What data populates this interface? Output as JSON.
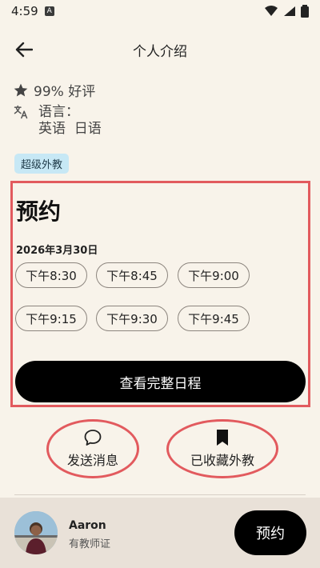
{
  "status_bar": {
    "time": "4:59",
    "sim_label": "A"
  },
  "header": {
    "title": "个人介绍"
  },
  "profile": {
    "rating": "99% 好评",
    "language_label": "语言：",
    "languages": "英语  日语",
    "badge": "超级外教"
  },
  "booking": {
    "title": "预约",
    "date": "2026年3月30日",
    "slots": [
      "下午8:30",
      "下午8:45",
      "下午9:00",
      "下午9:15",
      "下午9:30",
      "下午9:45"
    ],
    "full_schedule_label": "查看完整日程"
  },
  "actions": {
    "message_label": "发送消息",
    "saved_label": "已收藏外教"
  },
  "teacher": {
    "name": "Aaron",
    "cert": "有教师证"
  },
  "bottom": {
    "book_label": "预约"
  },
  "colors": {
    "background": "#f8f3ea",
    "annotation_red": "#e25a5e",
    "badge_bg": "#c7e8f5",
    "primary_button": "#000000",
    "bottom_bar": "#e9e1d8"
  }
}
